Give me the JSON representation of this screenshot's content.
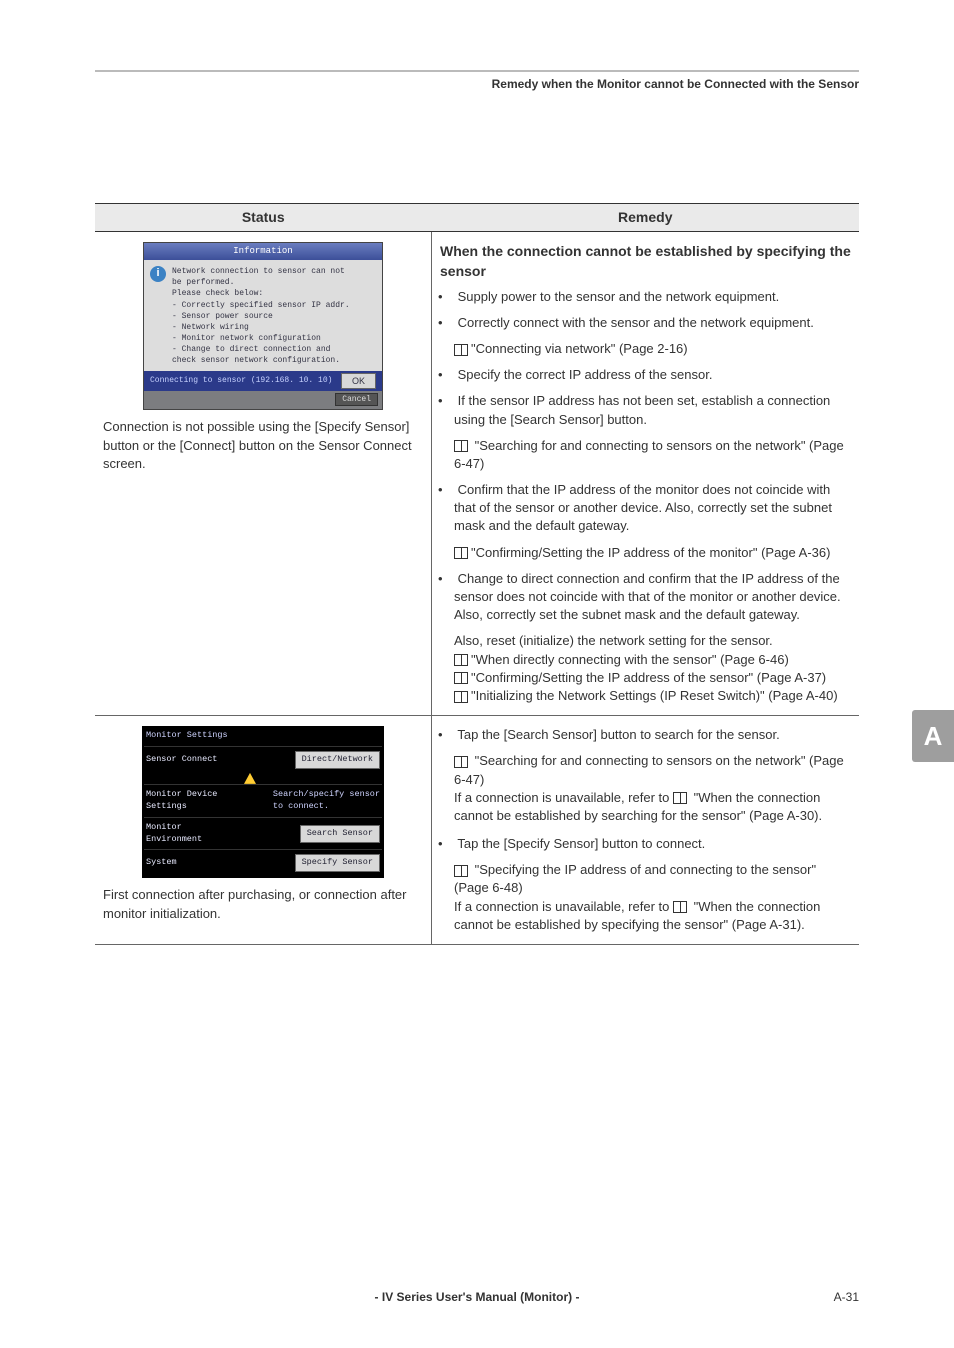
{
  "header_crumb": "Remedy when the Monitor cannot be Connected with the Sensor",
  "table_headers": {
    "status": "Status",
    "remedy": "Remedy"
  },
  "side_tab": "A",
  "dialog": {
    "title": "Information",
    "line1": "Network connection to sensor can not",
    "line2": "be performed.",
    "line3": "Please check below:",
    "line4": "- Correctly specified sensor IP addr.",
    "line5": "- Sensor power source",
    "line6": "- Network wiring",
    "line7": "- Monitor network configuration",
    "line8": "- Change to direct connection and",
    "line9": "  check sensor network configuration.",
    "strip": "Connecting to sensor (192.168. 10. 10)",
    "ok": "OK",
    "cancel": "Cancel"
  },
  "status1_caption": "Connection is not possible using the [Specify Sensor] button or the [Connect] button on the Sensor Connect screen.",
  "remedy1": {
    "heading": "When the connection cannot be established by specifying the sensor",
    "b1": "Supply power to the sensor and the network equipment.",
    "b2": "Correctly connect with the sensor and the network equipment.",
    "b2ref": "\"Connecting via network\" (Page 2-16)",
    "b3": "Specify the correct IP address of the sensor.",
    "b4": "If the sensor IP address has not been set, establish a connection using the [Search Sensor] button.",
    "b4ref": "\"Searching for and connecting to sensors on the network\" (Page 6-47)",
    "b5": "Confirm that the IP address of the monitor does not coincide with that of the sensor or another device. Also, correctly set the subnet mask and the default gateway.",
    "b5ref": "\"Confirming/Setting the IP address of the monitor\" (Page A-36)",
    "b6": "Change to direct connection and confirm that the IP address of the sensor does not coincide with that of the monitor or another device. Also, correctly set the subnet mask and the default gateway.",
    "b6b": "Also, reset (initialize) the network setting for the sensor.",
    "b6ref1": "\"When directly connecting with the sensor\" (Page 6-46)",
    "b6ref2": "\"Confirming/Setting the IP address of the sensor\" (Page A-37)",
    "b6ref3": "\"Initializing the Network Settings (IP Reset Switch)\" (Page A-40)"
  },
  "monitor_settings": {
    "title": "Monitor Settings",
    "row1": "Sensor Connect",
    "btn1": "Direct/Network",
    "row2": "Monitor Device\nSettings",
    "row2r": "Search/specify sensor\nto connect.",
    "row3": "Monitor\nEnvironment",
    "btn3": "Search Sensor",
    "row4": "System",
    "btn4": "Specify Sensor"
  },
  "status2_caption": "First connection after purchasing, or connection after monitor initialization.",
  "remedy2": {
    "b1": "Tap the [Search Sensor] button to search for the sensor.",
    "b1ref": "\"Searching for and connecting to sensors on the network\" (Page 6-47)",
    "b1tail_a": "If a connection is unavailable, refer to ",
    "b1tail_b": " \"When the connection cannot be established by searching for the sensor\" (Page A-30).",
    "b2": "Tap the [Specify Sensor] button to connect.",
    "b2ref": "\"Specifying the IP address of and connecting to the sensor\" (Page 6-48)",
    "b2tail_a": "If a connection is unavailable, refer to ",
    "b2tail_b": " \"When the connection cannot be established by specifying the sensor\" (Page A-31)."
  },
  "footer": {
    "center": "- IV Series User's Manual (Monitor) -",
    "right": "A-31"
  }
}
